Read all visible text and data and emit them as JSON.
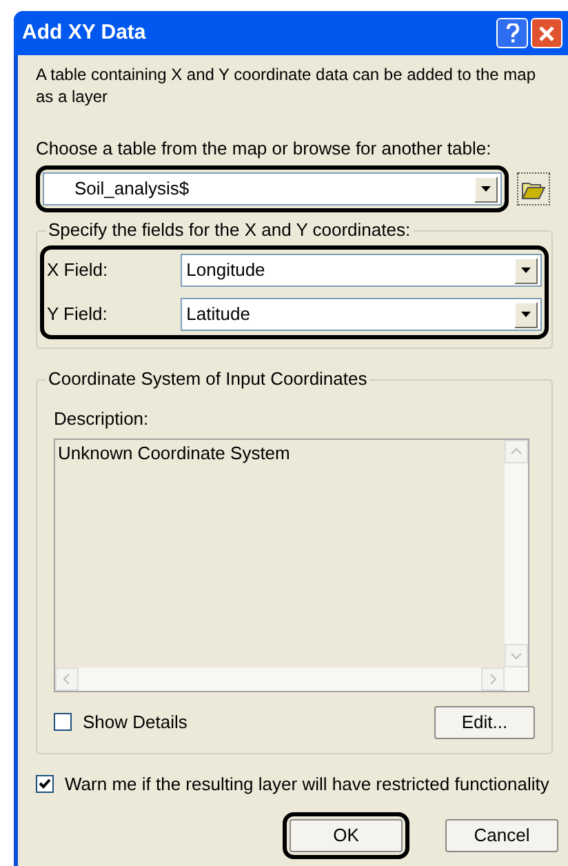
{
  "window": {
    "title": "Add XY Data"
  },
  "intro": "A table containing X and Y coordinate data can be added to the map as a layer",
  "table_prompt": "Choose a table from the map or browse for another table:",
  "table_combo": {
    "value": "Soil_analysis$",
    "highlighted": true
  },
  "fields_group": {
    "title": "Specify the fields for the X and Y coordinates:",
    "highlighted": true,
    "fields": [
      {
        "label": "X Field:",
        "value": "Longitude"
      },
      {
        "label": "Y Field:",
        "value": "Latitude"
      }
    ]
  },
  "coordinate_group": {
    "title": "Coordinate System of Input Coordinates",
    "description_label": "Description:",
    "description": "Unknown Coordinate System",
    "show_details": {
      "label": "Show Details",
      "checked": false
    },
    "edit_button": "Edit..."
  },
  "warn_checkbox": {
    "label": "Warn me if the resulting layer will have restricted functionality",
    "checked": true
  },
  "buttons": [
    {
      "label": "OK",
      "highlighted": true
    },
    {
      "label": "Cancel",
      "highlighted": false
    }
  ]
}
